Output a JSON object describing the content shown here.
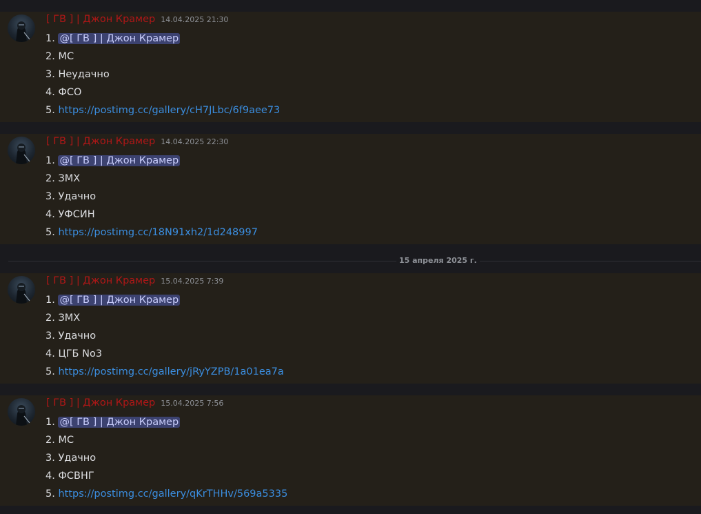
{
  "messages": [
    {
      "username": "[ ГВ ] | Джон Крамер",
      "timestamp": "14.04.2025 21:30",
      "n1": "1.",
      "mention": "@[ ГВ ] | Джон Крамер",
      "n2": "2.",
      "line2": "МС",
      "n3": "3.",
      "line3": "Неудачно",
      "n4": "4.",
      "line4": "ФСО",
      "n5": "5.",
      "link": "https://postimg.cc/gallery/cH7JLbc/6f9aee73"
    },
    {
      "username": "[ ГВ ] | Джон Крамер",
      "timestamp": "14.04.2025 22:30",
      "n1": "1.",
      "mention": "@[ ГВ ] | Джон Крамер",
      "n2": "2.",
      "line2": "ЗМХ",
      "n3": "3.",
      "line3": "Удачно",
      "n4": "4.",
      "line4": "УФСИН",
      "n5": "5.",
      "link": "https://postimg.cc/18N91xh2/1d248997"
    },
    {
      "username": "[ ГВ ] | Джон Крамер",
      "timestamp": "15.04.2025 7:39",
      "n1": "1.",
      "mention": "@[ ГВ ] | Джон Крамер",
      "n2": "2.",
      "line2": "ЗМХ",
      "n3": "3.",
      "line3": "Удачно",
      "n4": "4.",
      "line4": "ЦГБ No3",
      "n5": "5.",
      "link": "https://postimg.cc/gallery/jRyYZPB/1a01ea7a"
    },
    {
      "username": "[ ГВ ] | Джон Крамер",
      "timestamp": "15.04.2025 7:56",
      "n1": "1.",
      "mention": "@[ ГВ ] | Джон Крамер",
      "n2": "2.",
      "line2": "МС",
      "n3": "3.",
      "line3": "Удачно",
      "n4": "4.",
      "line4": "ФСВНГ",
      "n5": "5.",
      "link": "https://postimg.cc/gallery/qKrTHHv/569a5335"
    }
  ],
  "date_divider": "15 апреля 2025 г.",
  "colors": {
    "username": "#b01717",
    "mention_bg": "#3c4270",
    "mention_text": "#c9cdfb",
    "link": "#3b8ee0",
    "message_bg": "#242019",
    "page_bg": "#1a1a1e"
  }
}
